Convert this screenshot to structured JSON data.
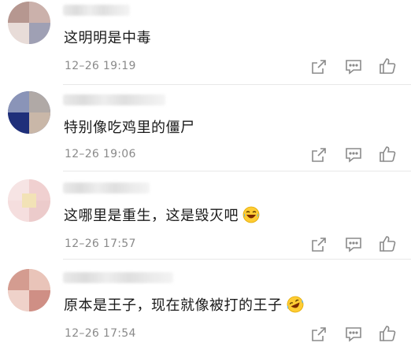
{
  "comments": [
    {
      "text": "这明明是中毒",
      "time": "12–26  19:19",
      "emoji": ""
    },
    {
      "text": "特别像吃鸡里的僵尸",
      "time": "12–26  19:06",
      "emoji": ""
    },
    {
      "text": "这哪里是重生，这是毁灭吧",
      "time": "12–26  17:57",
      "emoji": "laughing-tears"
    },
    {
      "text": "原本是王子，现在就像被打的王子",
      "time": "12–26  17:54",
      "emoji": "rolling-laughing"
    }
  ],
  "icons": {
    "share": "share-icon",
    "reply": "comment-icon",
    "like": "thumbs-up-icon"
  },
  "colors": {
    "text": "#1a1a1a",
    "time": "#8a8a8a",
    "icon": "#8a8a8a",
    "divider": "#e8e8e8",
    "emoji_face": "#ffcc33"
  }
}
